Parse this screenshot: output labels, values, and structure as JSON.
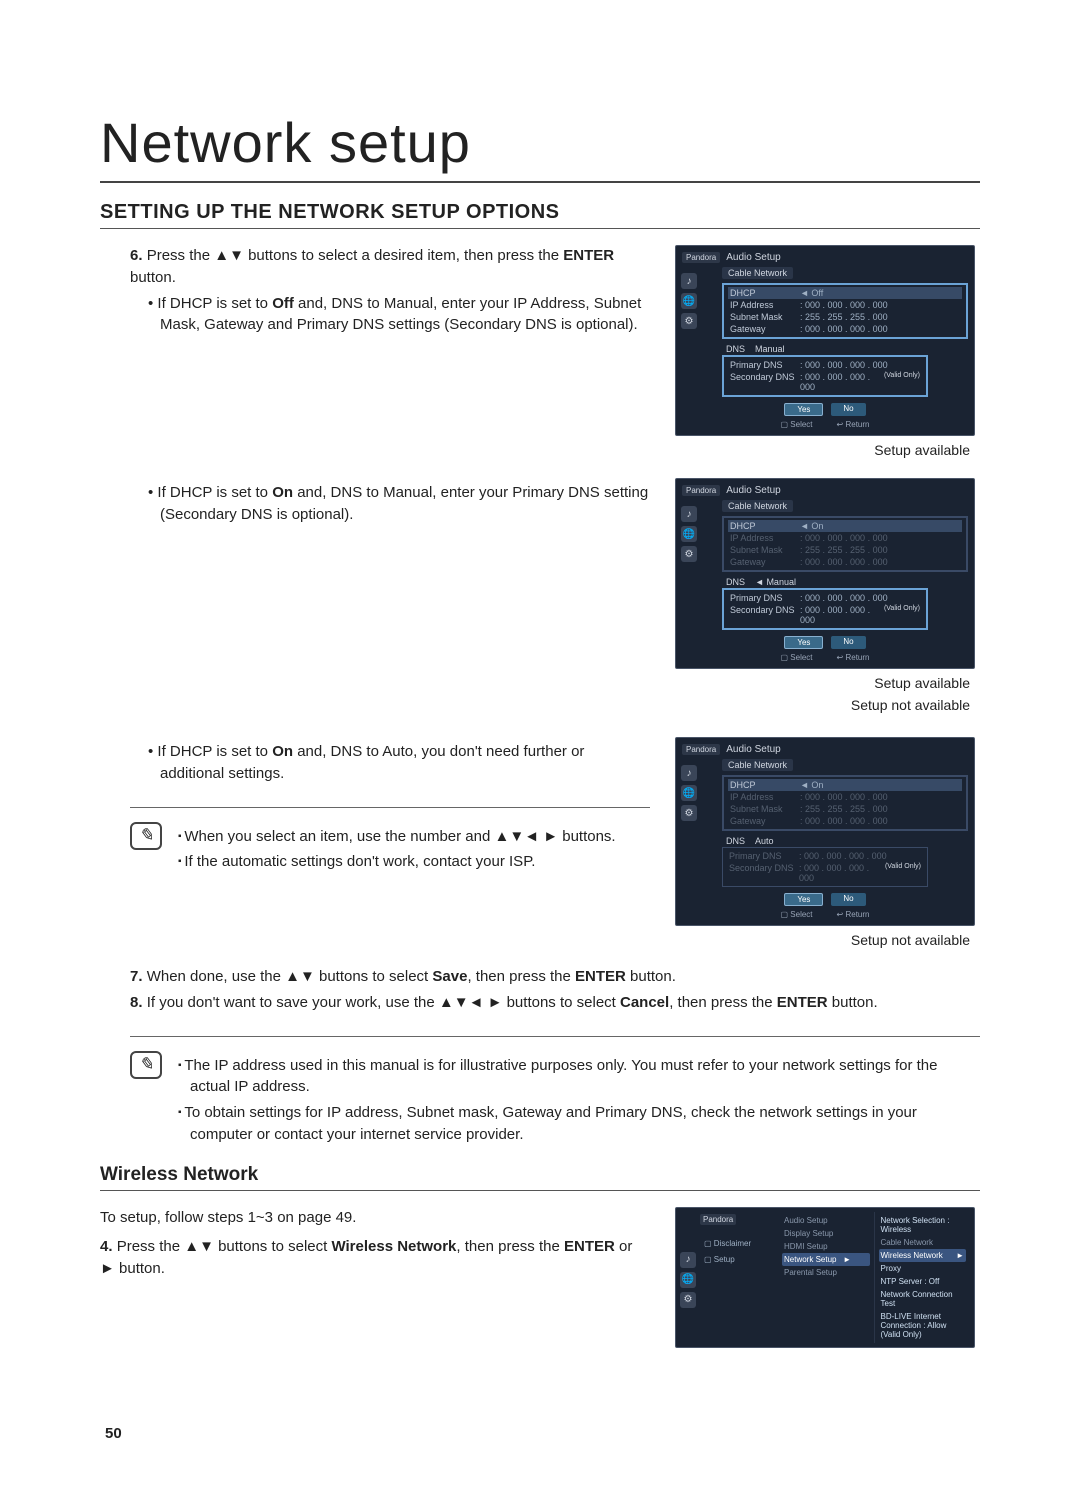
{
  "page": {
    "title": "Network setup",
    "section_heading": "SETTING UP THE NETWORK SETUP OPTIONS",
    "number": "50"
  },
  "steps": {
    "s6": {
      "num": "6.",
      "text_a": "Press the ▲▼ buttons to select a desired item, then press the ",
      "enter": "ENTER",
      "text_b": " button.",
      "b1_a": "If DHCP is set to ",
      "b1_off": "Off",
      "b1_b": " and, DNS to Manual, enter your IP Address, Subnet Mask, Gateway and Primary DNS settings (Secondary DNS is optional).",
      "b2_a": "If DHCP is set to ",
      "b2_on": "On",
      "b2_b": " and, DNS to Manual, enter your Primary DNS setting (Secondary DNS is optional).",
      "b3_a": "If DHCP is set to ",
      "b3_on": "On",
      "b3_b": " and, DNS to Auto, you don't need further or additional settings."
    },
    "tips1": {
      "t1": "When you select an item, use the number and ▲▼◄ ► buttons.",
      "t2": "If the automatic settings don't work, contact your ISP."
    },
    "s7": {
      "num": "7.",
      "text_a": "When done, use the ▲▼ buttons to select ",
      "save": "Save",
      "text_b": ", then press the ",
      "enter": "ENTER",
      "text_c": " button."
    },
    "s8": {
      "num": "8.",
      "text_a": "If you don't want to save your work, use the ▲▼◄ ► buttons to select ",
      "cancel": "Cancel",
      "text_b": ", then press the ",
      "enter": "ENTER",
      "text_c": " button."
    },
    "tips2": {
      "t1": "The IP address used in this manual is for illustrative purposes only. You must refer to your network settings for the actual IP address.",
      "t2": "To obtain settings for IP address, Subnet mask, Gateway and Primary DNS, check the network settings in your computer or contact your internet service provider."
    }
  },
  "wireless": {
    "heading": "Wireless Network",
    "intro": "To setup, follow steps 1~3 on page 49.",
    "s4": {
      "num": "4.",
      "text_a": "Press the ▲▼ buttons to select ",
      "wn": "Wireless Network",
      "text_b": ", then press the ",
      "enter": "ENTER",
      "text_c": " or ► button."
    }
  },
  "captions": {
    "avail": "Setup available",
    "notavail": "Setup not available"
  },
  "tv": {
    "logo": "Pandora",
    "title": "Audio Setup",
    "sub": "Cable Network",
    "fields": {
      "dhcp": "DHCP",
      "ip": "IP Address",
      "mask": "Subnet Mask",
      "gw": "Gateway",
      "dns": "DNS",
      "pdns": "Primary DNS",
      "sdns": "Secondary DNS"
    },
    "vals": {
      "off": "Off",
      "on": "On",
      "manual": "Manual",
      "auto": "Auto",
      "ip0": "000 . 000 . 000 . 000",
      "mask0": "255 . 255 . 255 . 000",
      "valid": "(Valid Only)"
    },
    "btns": {
      "yes": "Yes",
      "no": "No"
    },
    "foot": {
      "sel": "Select",
      "ret": "Return"
    }
  },
  "tv2": {
    "side": {
      "audio": "Audio Setup",
      "display": "Display Setup",
      "hdmi": "HDMI Setup",
      "network": "Network Setup",
      "parental": "Parental Setup",
      "disclaimer": "Disclaimer",
      "setup": "Setup"
    },
    "main": {
      "netsel": "Network Selection  :  Wireless",
      "cable": "Cable Network",
      "wireless": "Wireless Network",
      "proxy": "Proxy",
      "ntp": "NTP Server            :  Off",
      "test": "Network Connection Test",
      "bdlive": "BD-LIVE Internet Connection",
      "bdval": ": Allow (Valid Only)"
    }
  }
}
